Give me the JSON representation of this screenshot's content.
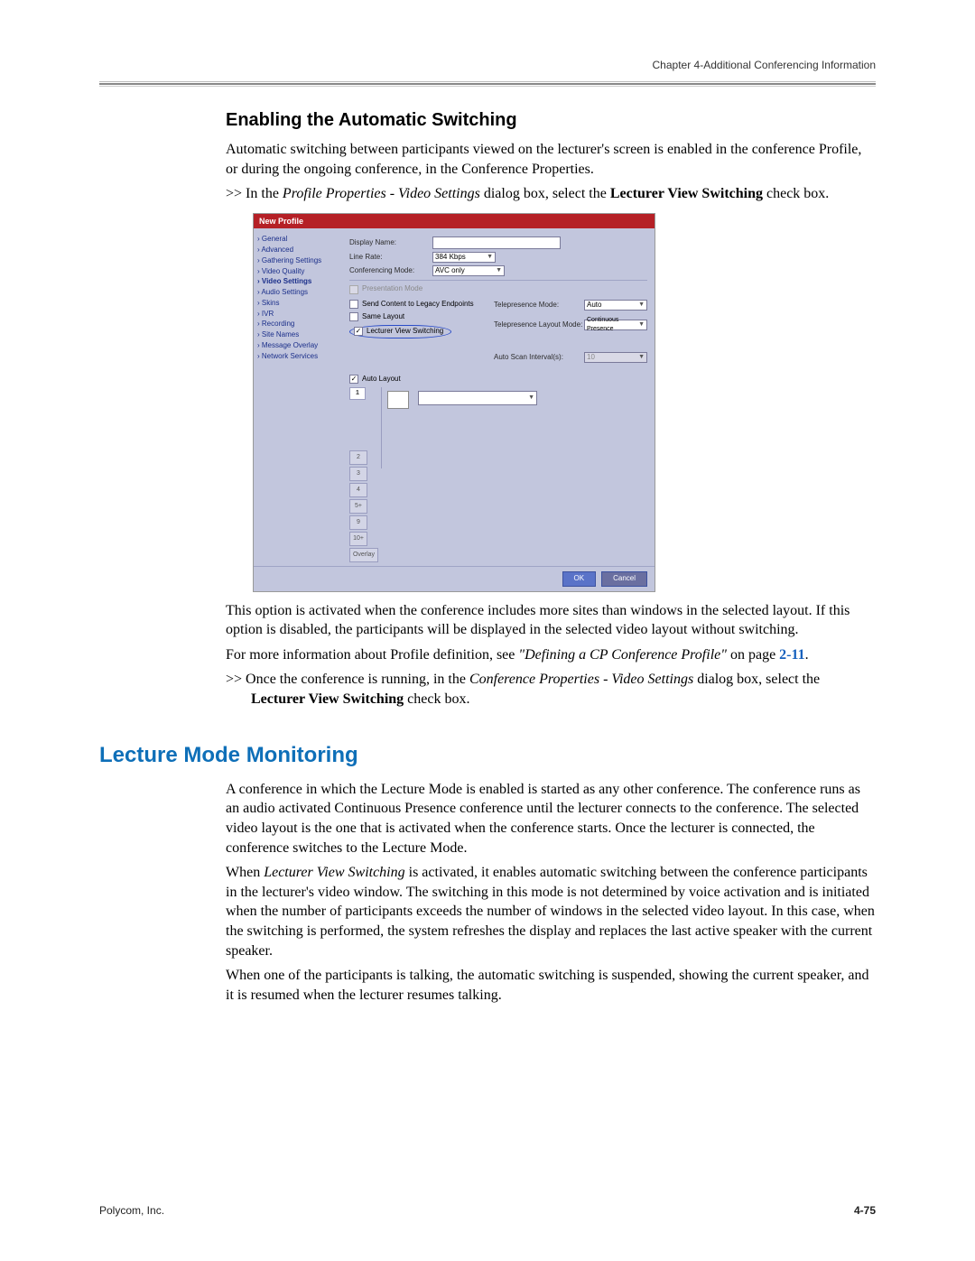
{
  "header": {
    "chapter_line": "Chapter 4-Additional Conferencing Information"
  },
  "section1": {
    "heading": "Enabling the Automatic Switching",
    "p1": "Automatic switching between participants viewed on the lecturer's screen is enabled in the conference Profile, or during the ongoing conference, in the Conference Properties.",
    "bullet1_pre": ">>   In the ",
    "bullet1_it1": "Profile Properties - Video Settings",
    "bullet1_mid": " dialog box, select the ",
    "bullet1_bold": "Lecturer View Switching",
    "bullet1_post": " check box.",
    "p2": "This option is activated when the conference includes more sites than windows in the selected layout. If this option is disabled, the participants will be displayed in the selected video layout without switching.",
    "p3_a": "For more information about Profile definition, see ",
    "p3_it": "\"Defining a CP Conference Profile\"",
    "p3_b": " on page ",
    "p3_link": "2-11",
    "p3_c": ".",
    "bullet2_pre": ">>   Once the conference is running, in the ",
    "bullet2_it": "Conference Properties - Video Settings",
    "bullet2_mid": " dialog box, select the ",
    "bullet2_bold": "Lecturer View Switching",
    "bullet2_post": " check box."
  },
  "dialog": {
    "title": "New Profile",
    "nav": [
      "General",
      "Advanced",
      "Gathering Settings",
      "Video Quality",
      "Video Settings",
      "Audio Settings",
      "Skins",
      "IVR",
      "Recording",
      "Site Names",
      "Message Overlay",
      "Network Services"
    ],
    "nav_active_index": 4,
    "labels": {
      "display_name": "Display Name:",
      "line_rate": "Line Rate:",
      "conferencing_mode": "Conferencing Mode:",
      "presentation_mode": "Presentation Mode",
      "send_content": "Send Content to Legacy Endpoints",
      "same_layout": "Same Layout",
      "lecturer_view_switching": "Lecturer View Switching",
      "telepresence_mode": "Telepresence Mode:",
      "telepresence_layout_mode": "Telepresence Layout Mode:",
      "auto_scan_interval": "Auto Scan Interval(s):",
      "auto_layout": "Auto Layout"
    },
    "values": {
      "line_rate": "384 Kbps",
      "conferencing_mode": "AVC only",
      "telepresence_mode": "Auto",
      "telepresence_layout_mode": "Continuous Presence",
      "auto_scan_interval": "10"
    },
    "layout_buttons": [
      "1",
      "2",
      "3",
      "4",
      "5+",
      "9",
      "10+",
      "Overlay"
    ],
    "layout_selected_index": 0,
    "buttons": {
      "ok": "OK",
      "cancel": "Cancel"
    }
  },
  "section2": {
    "heading": "Lecture Mode Monitoring",
    "p1": "A conference in which the Lecture Mode is enabled is started as any other conference. The conference runs as an audio activated Continuous Presence conference until the lecturer connects to the conference. The selected video layout is the one that is activated when the conference starts. Once the lecturer is connected, the conference switches to the Lecture Mode.",
    "p2_a": "When ",
    "p2_it": "Lecturer View Switching",
    "p2_b": " is activated, it enables automatic switching between the conference participants in the lecturer's video window. The switching in this mode is not determined by voice activation and is initiated when the number of participants exceeds the number of windows in the selected video layout. In this case, when the switching is performed, the system refreshes the display and replaces the last active speaker with the current speaker.",
    "p3": "When one of the participants is talking, the automatic switching is suspended, showing the current speaker, and it is resumed when the lecturer resumes talking."
  },
  "footer": {
    "left": "Polycom, Inc.",
    "right": "4-75"
  }
}
